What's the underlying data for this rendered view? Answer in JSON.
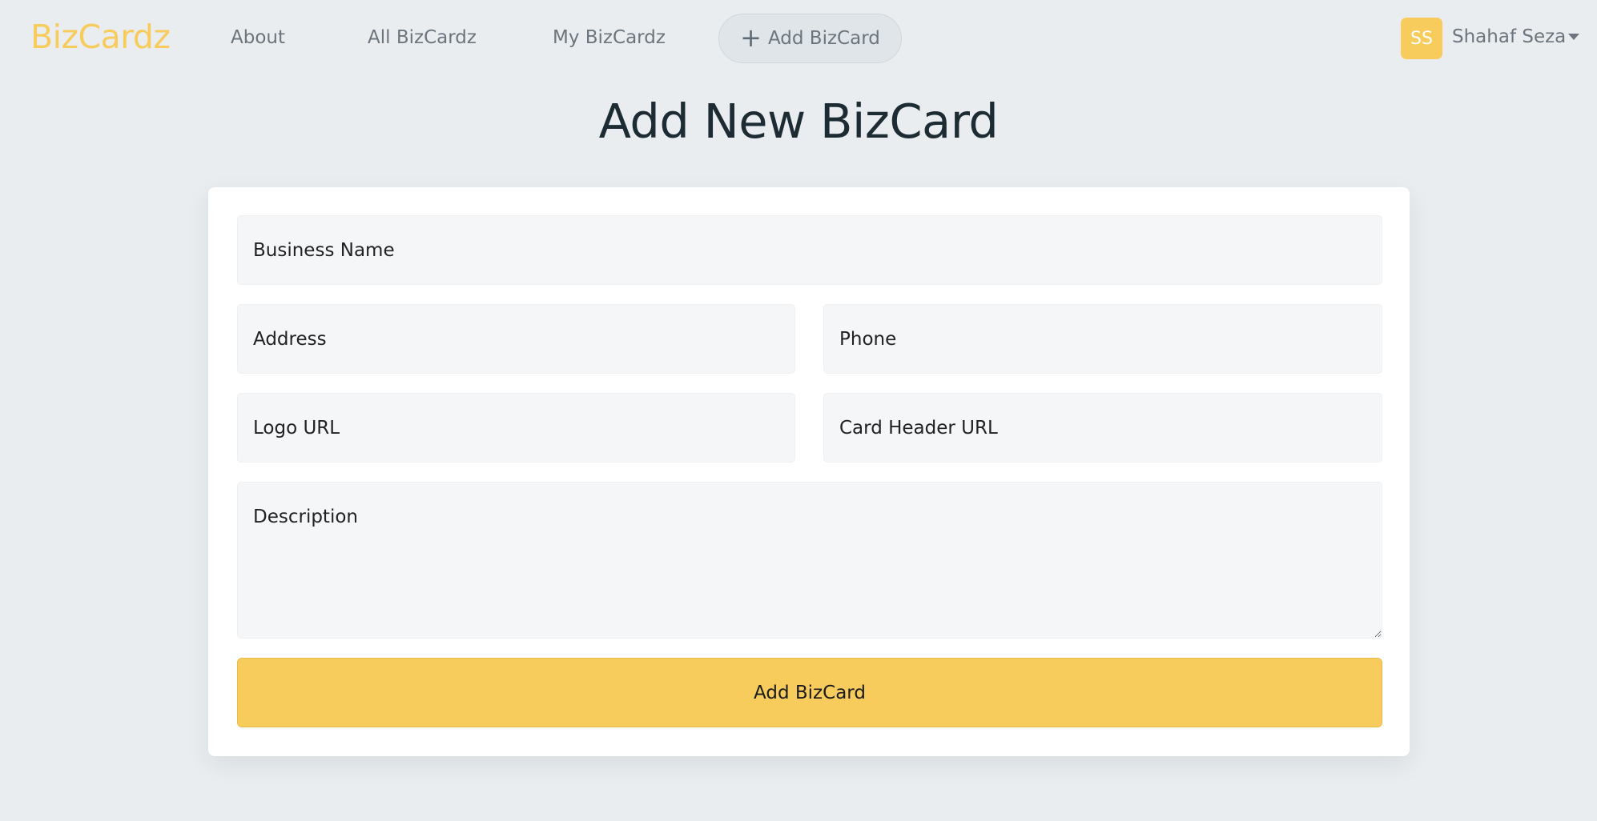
{
  "navbar": {
    "brand": "BizCardz",
    "links": {
      "about": "About",
      "all_bizcardz": "All BizCardz",
      "my_bizcardz": "My BizCardz",
      "add_bizcard": "Add BizCard"
    },
    "user": {
      "initials": "SS",
      "name": "Shahaf Seza"
    }
  },
  "page": {
    "title": "Add New BizCard"
  },
  "form": {
    "business_name": {
      "placeholder": "Business Name",
      "value": ""
    },
    "address": {
      "placeholder": "Address",
      "value": ""
    },
    "phone": {
      "placeholder": "Phone",
      "value": ""
    },
    "logo_url": {
      "placeholder": "Logo URL",
      "value": ""
    },
    "card_header_url": {
      "placeholder": "Card Header URL",
      "value": ""
    },
    "description": {
      "placeholder": "Description",
      "value": ""
    },
    "submit_label": "Add BizCard"
  },
  "colors": {
    "accent": "#f7cc5d",
    "background": "#e9edf0",
    "card": "#ffffff",
    "field": "#f5f6f8"
  },
  "icons": {
    "add": "plus-icon",
    "user_menu": "caret-down-icon"
  }
}
